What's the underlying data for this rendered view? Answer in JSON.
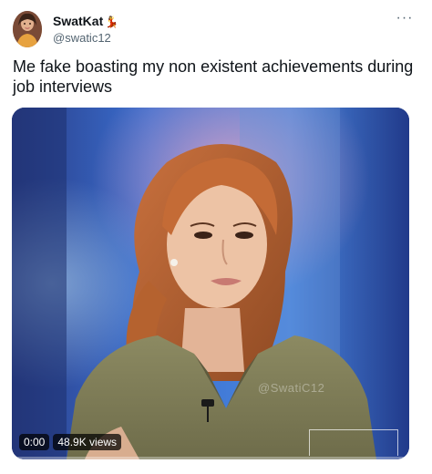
{
  "author": {
    "display_name": "SwatKat",
    "name_emoji": "💃",
    "handle": "@swatic12",
    "avatar_icon": "profile-photo"
  },
  "menu": {
    "more_icon": "more-horizontal-icon",
    "more_glyph": "···"
  },
  "tweet": {
    "text": "Me fake boasting my non existent achievements during job interviews"
  },
  "video": {
    "elapsed": "0:00",
    "views": "48.9K views",
    "watermark": "@SwatiC12",
    "progress_fraction": 0.0
  },
  "colors": {
    "text_primary": "#0f1419",
    "text_secondary": "#536471",
    "accent": "#1d9bf0"
  }
}
